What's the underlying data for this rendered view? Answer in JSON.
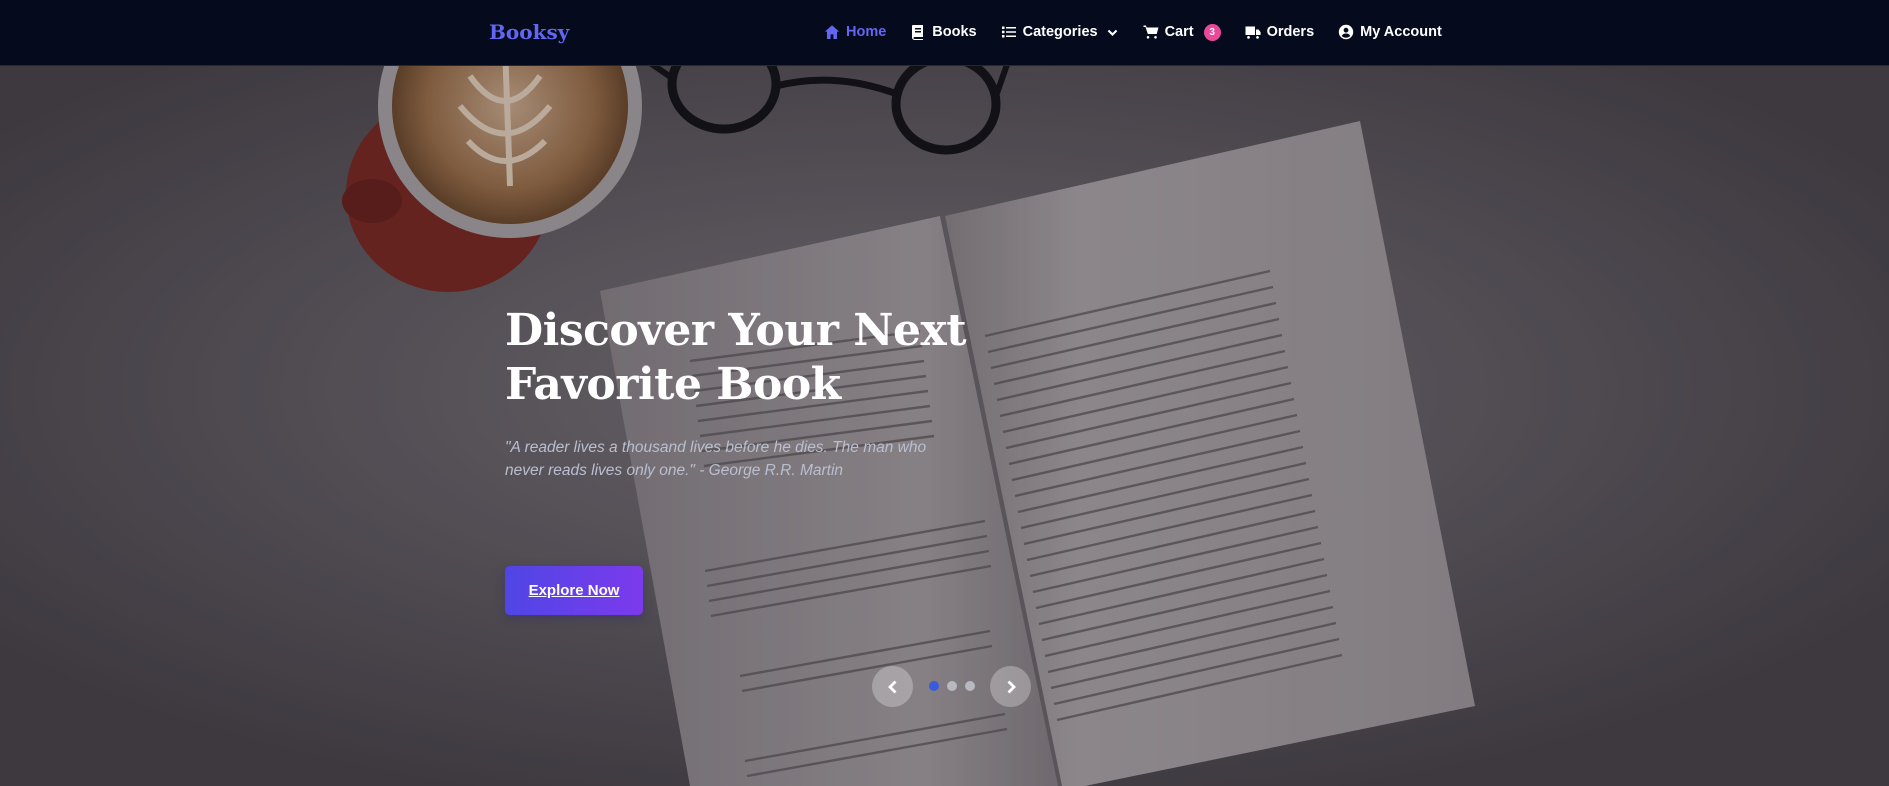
{
  "nav": {
    "brand": "Booksy",
    "links": [
      {
        "label": "Home",
        "icon": "home-icon"
      },
      {
        "label": "Books",
        "icon": "book-icon"
      },
      {
        "label": "Categories",
        "icon": "list-icon"
      },
      {
        "label": "Cart",
        "icon": "cart-icon"
      },
      {
        "label": "Orders",
        "icon": "truck-icon"
      },
      {
        "label": "My Account",
        "icon": "user-circle-icon"
      }
    ],
    "cart_count": "3",
    "active_link": "Home"
  },
  "hero": {
    "title_line1": "Discover Your Next",
    "title_line2": "Favorite Book",
    "quote_line1": "\"A reader lives a thousand lives before he dies. The man who",
    "quote_line2": "never reads lives only one.\" - George R.R. Martin",
    "button_label": "Explore Now"
  },
  "carousel": {
    "slide_count": 3,
    "active_slide": 1,
    "prev_icon": "chevron-left-icon",
    "next_icon": "chevron-right-icon"
  },
  "colors": {
    "nav_bg": "#050a1c",
    "accent": "#6366f1",
    "badge": "#ec4899",
    "button_start": "#4f46e5",
    "button_end": "#7c3aed",
    "active_dot": "#3b5bdb"
  }
}
